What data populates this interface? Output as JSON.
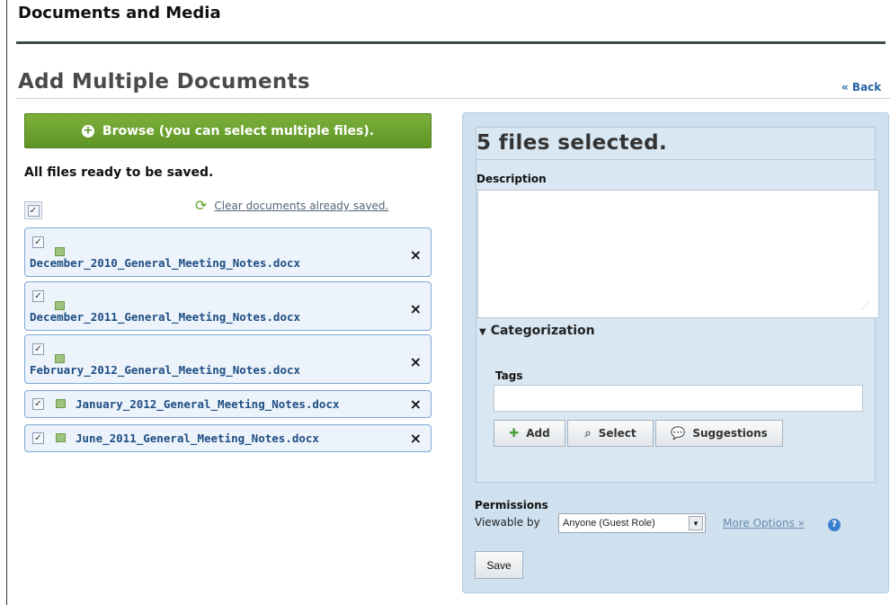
{
  "header": {
    "app_title": "Documents and Media",
    "section_title": "Add Multiple Documents",
    "back_label": "« Back"
  },
  "upload": {
    "browse_label": "Browse (you can select multiple files).",
    "status_text": "All files ready to be saved.",
    "clear_label": "Clear documents already saved.",
    "select_all_checked": true,
    "remove_symbol": "×",
    "files": [
      {
        "name": "December_2010_General_Meeting_Notes.docx",
        "checked": true
      },
      {
        "name": "December_2011_General_Meeting_Notes.docx",
        "checked": true
      },
      {
        "name": "February_2012_General_Meeting_Notes.docx",
        "checked": true
      },
      {
        "name": "January_2012_General_Meeting_Notes.docx",
        "checked": true
      },
      {
        "name": "June_2011_General_Meeting_Notes.docx",
        "checked": true
      }
    ]
  },
  "details": {
    "files_selected": "5 files selected.",
    "description_label": "Description",
    "description_value": "",
    "categorization_label": "Categorization",
    "tags_label": "Tags",
    "tags_value": "",
    "add_label": "Add",
    "select_label": "Select",
    "suggestions_label": "Suggestions"
  },
  "permissions": {
    "label": "Permissions",
    "viewable_by_label": "Viewable by",
    "viewable_by_value": "Anyone (Guest Role)",
    "more_options_label": "More Options »",
    "save_label": "Save"
  },
  "colors": {
    "browse_button": "#6aa02e",
    "panel_background": "#cfe1ee",
    "file_item_border": "#7fa7d6",
    "link": "#2a64a7"
  },
  "icons": {
    "browse": "plus-circle-icon",
    "clear": "refresh-icon",
    "remove": "close-icon",
    "add": "plus-icon",
    "select": "search-icon",
    "suggestions": "speech-bubble-icon",
    "help": "help-icon"
  }
}
